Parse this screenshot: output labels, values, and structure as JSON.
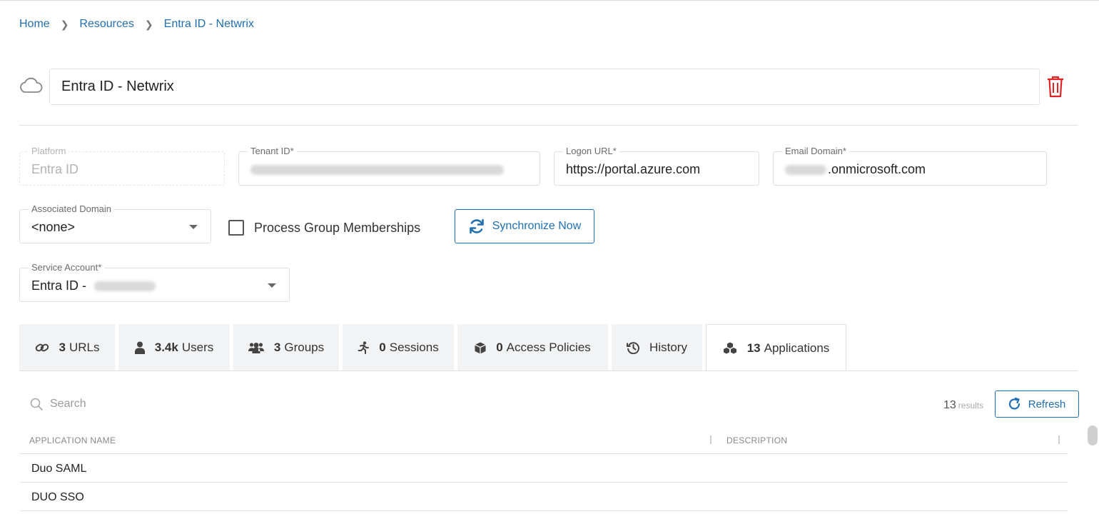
{
  "breadcrumb": [
    "Home",
    "Resources",
    "Entra ID - Netwrix"
  ],
  "resource": {
    "name": "Entra ID - Netwrix"
  },
  "fields": {
    "platform": {
      "label": "Platform",
      "value": "Entra ID"
    },
    "tenant_id": {
      "label": "Tenant ID*"
    },
    "logon_url": {
      "label": "Logon URL*",
      "value": "https://portal.azure.com"
    },
    "email_domain": {
      "label": "Email Domain*",
      "value": ".onmicrosoft.com"
    },
    "associated_domain": {
      "label": "Associated Domain",
      "value": "<none>"
    },
    "service_account": {
      "label": "Service Account*",
      "value": "Entra ID - "
    }
  },
  "process_group_memberships": {
    "label": "Process Group Memberships",
    "checked": false
  },
  "sync_button": "Synchronize Now",
  "tabs": [
    {
      "count": "3",
      "label": "URLs",
      "icon": "link-icon"
    },
    {
      "count": "3.4k",
      "label": "Users",
      "icon": "user-icon"
    },
    {
      "count": "3",
      "label": "Groups",
      "icon": "users-icon"
    },
    {
      "count": "0",
      "label": "Sessions",
      "icon": "running-icon"
    },
    {
      "count": "0",
      "label": "Access Policies",
      "icon": "cube-icon"
    },
    {
      "count": "",
      "label": "History",
      "icon": "history-icon"
    },
    {
      "count": "13",
      "label": "Applications",
      "icon": "applications-icon",
      "active": true
    }
  ],
  "search": {
    "placeholder": "Search"
  },
  "results": {
    "count": "13",
    "label": "results"
  },
  "refresh_button": "Refresh",
  "table": {
    "columns": [
      "APPLICATION NAME",
      "DESCRIPTION"
    ],
    "rows": [
      {
        "name": "Duo SAML",
        "description": ""
      },
      {
        "name": "DUO SSO",
        "description": ""
      }
    ]
  },
  "colors": {
    "accent": "#1f6fb2",
    "danger": "#e02424"
  }
}
